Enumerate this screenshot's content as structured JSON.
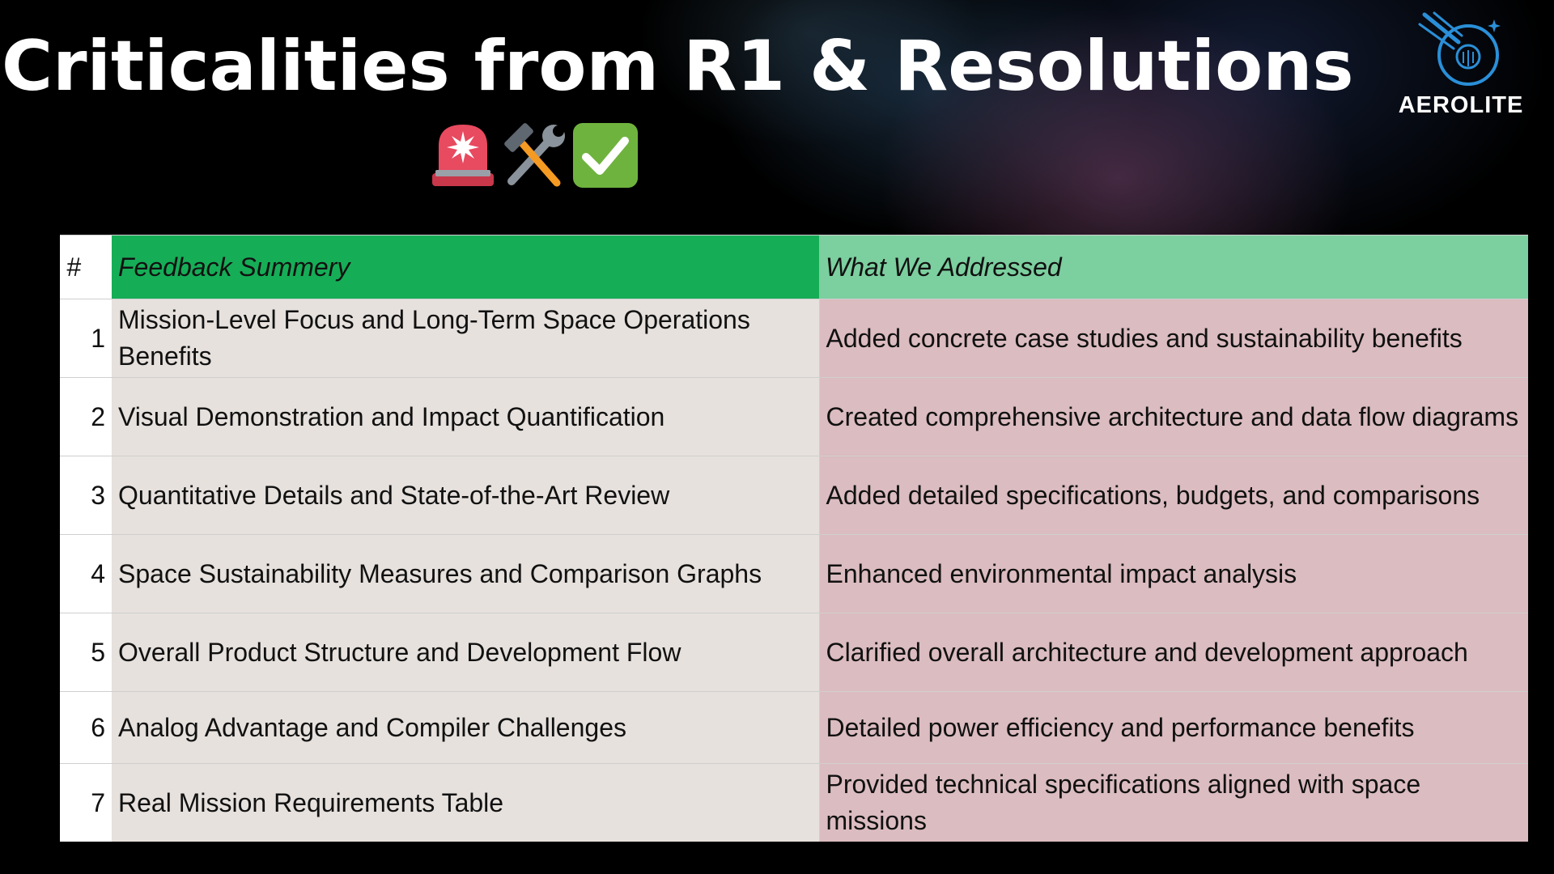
{
  "slide": {
    "title": "Criticalities from R1 & Resolutions",
    "emojis": [
      "rotating-light-icon",
      "hammer-and-wrench-icon",
      "check-mark-button-icon"
    ]
  },
  "logo": {
    "name": "AEROLITE",
    "icon": "aerolite-meteor-logo-icon",
    "accent_color": "#2a8fd8"
  },
  "table": {
    "headers": {
      "number": "#",
      "feedback": "Feedback Summery",
      "addressed": "What We Addressed"
    },
    "colors": {
      "feedback_header": "#16ad57",
      "addressed_header": "#7ccf9f",
      "feedback_cells": "#e6e1dd",
      "addressed_cells": "#dbbcc0"
    },
    "rows": [
      {
        "number": "1",
        "feedback": "Mission-Level Focus and Long-Term Space Operations Benefits",
        "addressed": "Added concrete case studies and sustainability benefits"
      },
      {
        "number": "2",
        "feedback": "Visual Demonstration and Impact Quantification",
        "addressed": "Created comprehensive architecture and data flow diagrams"
      },
      {
        "number": "3",
        "feedback": "Quantitative Details and State-of-the-Art Review",
        "addressed": "Added detailed specifications, budgets, and comparisons"
      },
      {
        "number": "4",
        "feedback": "Space Sustainability Measures and Comparison Graphs",
        "addressed": "Enhanced environmental impact analysis"
      },
      {
        "number": "5",
        "feedback": "Overall Product Structure and Development Flow",
        "addressed": "Clarified overall architecture and development approach"
      },
      {
        "number": "6",
        "feedback": "Analog Advantage and Compiler Challenges",
        "addressed": "Detailed power efficiency and performance benefits"
      },
      {
        "number": "7",
        "feedback": "Real Mission Requirements Table",
        "addressed": "Provided technical specifications aligned with space missions"
      }
    ]
  }
}
